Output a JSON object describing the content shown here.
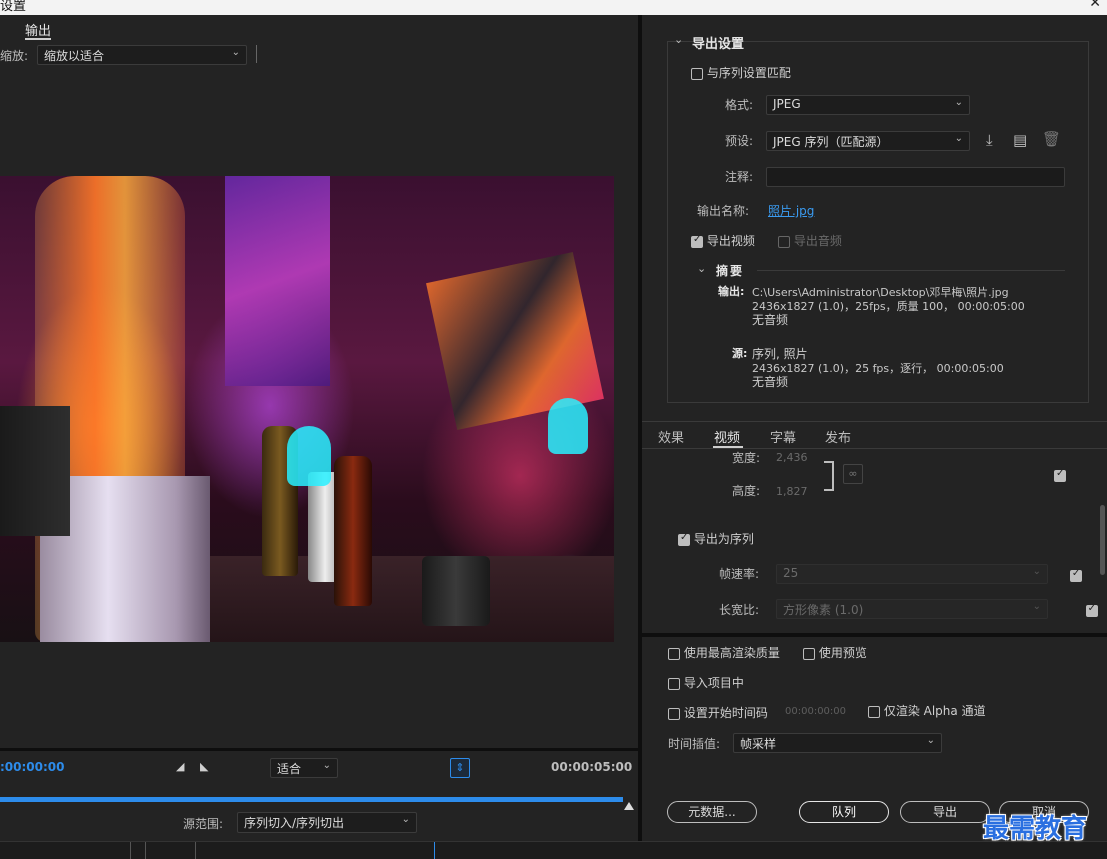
{
  "window": {
    "title": "设置",
    "close": "✕"
  },
  "left": {
    "tab": "输出",
    "scale_label": "缩放:",
    "scale_value": "缩放以适合",
    "timecode_start": ":00:00:00",
    "fit_value": "适合",
    "timecode_end": "00:00:05:00",
    "source_range_label": "源范围:",
    "source_range_value": "序列切入/序列切出"
  },
  "export": {
    "section_title": "导出设置",
    "match_sequence": "与序列设置匹配",
    "format_label": "格式:",
    "format_value": "JPEG",
    "preset_label": "预设:",
    "preset_value": "JPEG 序列（匹配源）",
    "comment_label": "注释:",
    "comment_value": "",
    "output_name_label": "输出名称:",
    "output_name_value": "照片.jpg",
    "export_video": "导出视频",
    "export_audio": "导出音频",
    "summary_title": "摘要",
    "summary_output_label": "输出:",
    "summary_output_path": "C:\\Users\\Administrator\\Desktop\\邓早梅\\照片.jpg",
    "summary_output_line2": "2436x1827  (1.0)，25fps，质量 100，  00:00:05:00",
    "summary_output_line3": "无音频",
    "summary_source_label": "源:",
    "summary_source_line1": "序列, 照片",
    "summary_source_line2": "2436x1827  (1.0)，25 fps，逐行，  00:00:05:00",
    "summary_source_line3": "无音频"
  },
  "tabs": [
    "效果",
    "视频",
    "字幕",
    "发布"
  ],
  "video": {
    "width_label": "宽度:",
    "width_value": "2,436",
    "height_label": "高度:",
    "height_value": "1,827",
    "export_sequence": "导出为序列",
    "framerate_label": "帧速率:",
    "framerate_value": "25",
    "aspect_label": "长宽比:",
    "aspect_value": "方形像素 (1.0)"
  },
  "options": {
    "max_render": "使用最高渲染质量",
    "use_preview": "使用预览",
    "import_project": "导入项目中",
    "start_timecode": "设置开始时间码",
    "start_timecode_value": "00:00:00:00",
    "alpha_only": "仅渲染 Alpha 通道",
    "interp_label": "时间插值:",
    "interp_value": "帧采样"
  },
  "buttons": {
    "metadata": "元数据...",
    "queue": "队列",
    "export": "导出",
    "cancel": "取消"
  },
  "watermark": "最需教育",
  "icons": [
    "chevron-down-icon",
    "save-preset-icon",
    "import-preset-icon",
    "trash-icon",
    "link-icon",
    "in-point-icon",
    "out-point-icon",
    "fit-to-frame-icon"
  ]
}
